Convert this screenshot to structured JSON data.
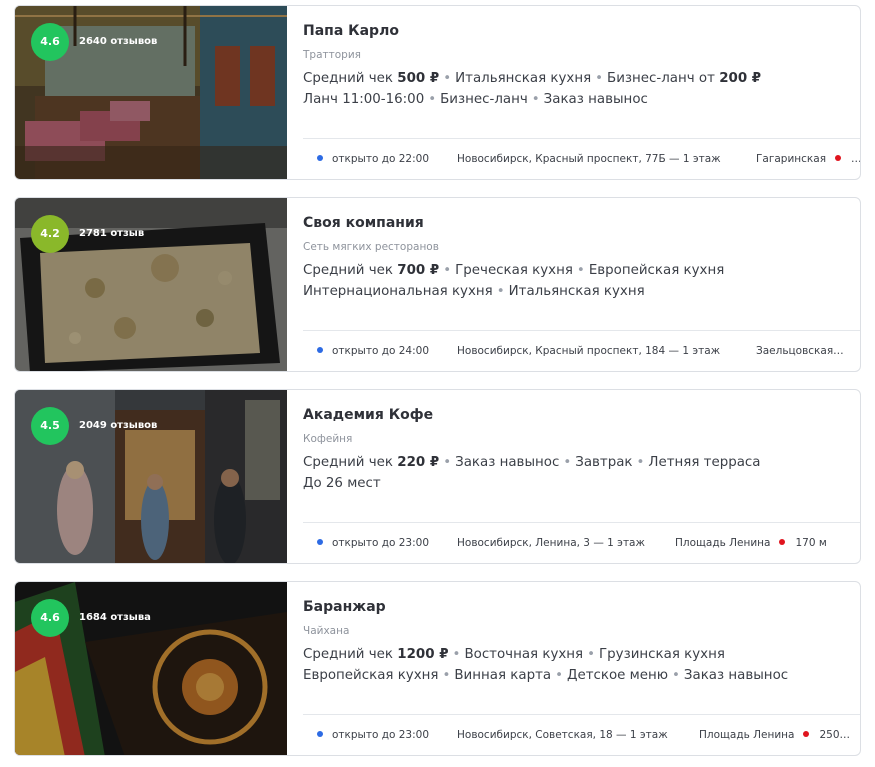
{
  "colors": {
    "rating_green": "#22c55e",
    "rating_olive": "#8ab82a",
    "open_dot": "#2d6be4",
    "metro_dot": "#e0141e"
  },
  "cards": [
    {
      "rating": "4.6",
      "reviews": "2640 отзывов",
      "name": "Папа Карло",
      "category": "Траттория",
      "line1": {
        "check_label": "Средний чек",
        "check_value": "500 ₽",
        "tags": [
          "Итальянская кухня"
        ],
        "extra_label": "Бизнес-ланч от",
        "extra_value": "200 ₽"
      },
      "line2": [
        "Ланч 11:00-16:00",
        "Бизнес-ланч",
        "Заказ навынос"
      ],
      "open": "открыто до 22:00",
      "address": "Новосибирск, Красный проспект, 77Б — 1 этаж",
      "metro": "Гагаринская",
      "metro_suffix": "…"
    },
    {
      "rating": "4.2",
      "reviews": "2781 отзыв",
      "name": "Своя компания",
      "category": "Сеть мягких ресторанов",
      "line1": {
        "check_label": "Средний чек",
        "check_value": "700 ₽",
        "tags": [
          "Греческая кухня",
          "Европейская кухня"
        ]
      },
      "line2": [
        "Интернациональная кухня",
        "Итальянская кухня"
      ],
      "open": "открыто до 24:00",
      "address": "Новосибирск, Красный проспект, 184 — 1 этаж",
      "metro": "Заельцовская…"
    },
    {
      "rating": "4.5",
      "reviews": "2049 отзывов",
      "name": "Академия Кофе",
      "category": "Кофейня",
      "line1": {
        "check_label": "Средний чек",
        "check_value": "220 ₽",
        "tags": [
          "Заказ навынос",
          "Завтрак",
          "Летняя терраса"
        ]
      },
      "line2": [
        "До 26 мест"
      ],
      "open": "открыто до 23:00",
      "address": "Новосибирск, Ленина, 3 — 1 этаж",
      "metro": "Площадь Ленина",
      "distance": "170 м"
    },
    {
      "rating": "4.6",
      "reviews": "1684 отзыва",
      "name": "Баранжар",
      "category": "Чайхана",
      "line1": {
        "check_label": "Средний чек",
        "check_value": "1200 ₽",
        "tags": [
          "Восточная кухня",
          "Грузинская кухня"
        ]
      },
      "line2": [
        "Европейская кухня",
        "Винная карта",
        "Детское меню",
        "Заказ навынос"
      ],
      "open": "открыто до 23:00",
      "address": "Новосибирск, Советская, 18 — 1 этаж",
      "metro": "Площадь Ленина",
      "distance": "250…"
    }
  ]
}
